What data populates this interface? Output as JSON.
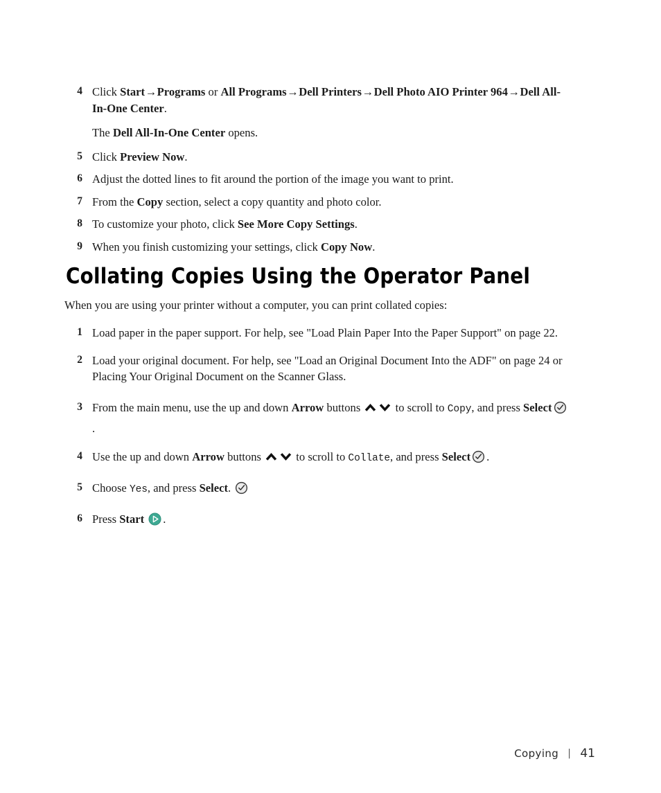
{
  "document": {
    "type": "printer-user-manual-page"
  },
  "top_steps": [
    {
      "num": "4",
      "prefix": "Click ",
      "bold1": "Start",
      "arrow1": "→",
      "bold2": "Programs",
      "mid": " or ",
      "bold3": "All Programs",
      "arrow2": "→",
      "bold4": "Dell Printers",
      "arrow3": "→",
      "bold5": "Dell Photo AIO Printer 964",
      "arrow4": "→",
      "bold6": "Dell All-In-One Center",
      "suffix": "."
    },
    {
      "num": "5",
      "prefix": "Click ",
      "bold": "Preview Now",
      "suffix": "."
    },
    {
      "num": "6",
      "text": "Adjust the dotted lines to fit around the portion of the image you want to print."
    },
    {
      "num": "7",
      "prefix": "From the ",
      "bold": "Copy",
      "suffix": " section, select a copy quantity and photo color."
    },
    {
      "num": "8",
      "prefix": "To customize your photo, click ",
      "bold": "See More Copy Settings",
      "suffix": "."
    },
    {
      "num": "9",
      "prefix": "When you finish customizing your settings, click ",
      "bold": "Copy Now",
      "suffix": "."
    }
  ],
  "note": {
    "prefix": "The ",
    "bold": "Dell All-In-One Center",
    "suffix": " opens."
  },
  "heading": {
    "title": "Collating Copies Using the Operator Panel"
  },
  "intro": {
    "text": "When you are using your printer without a computer, you can print collated copies:"
  },
  "collate_steps": {
    "s1": {
      "num": "1",
      "text": "Load paper in the paper support. For help, see \"Load Plain Paper Into the Paper Support\" on page 22."
    },
    "s2": {
      "num": "2",
      "text": "Load your original document. For help, see \"Load an Original Document Into the ADF\" on page 24 or Placing Your Original Document on the Scanner Glass."
    },
    "s3": {
      "num": "3",
      "part1": "From the main menu, use the up and down ",
      "bold1": "Arrow",
      "part2": " buttons ",
      "part3": " to scroll to ",
      "mono1": "Copy",
      "part4": ", and press ",
      "bold2": "Select",
      "part5": "."
    },
    "s4": {
      "num": "4",
      "part1": "Use the up and down ",
      "bold1": "Arrow",
      "part2": " buttons ",
      "part3": " to scroll to ",
      "mono1": "Collate",
      "part4": ", and press ",
      "bold2": "Select",
      "part5": "."
    },
    "s5": {
      "num": "5",
      "part1": "Choose ",
      "mono1": "Yes",
      "part2": ", and press ",
      "bold1": "Select",
      "part3": ". "
    },
    "s6": {
      "num": "6",
      "part1": "Press ",
      "bold1": "Start",
      "part2": " ",
      "part3": "."
    }
  },
  "icons": {
    "arrow_up": "chevron-up-icon",
    "arrow_down": "chevron-down-icon",
    "select": "select-check-circle-icon",
    "start": "start-play-circle-icon"
  },
  "colors": {
    "start_green": "#3EA993",
    "select_fill": "#E9E9E9",
    "select_stroke": "#3C3C3C",
    "text": "#1c1c1c",
    "page_bg": "#ffffff"
  },
  "footer": {
    "chapter": "Copying",
    "separator": "|",
    "page_number": "41"
  }
}
